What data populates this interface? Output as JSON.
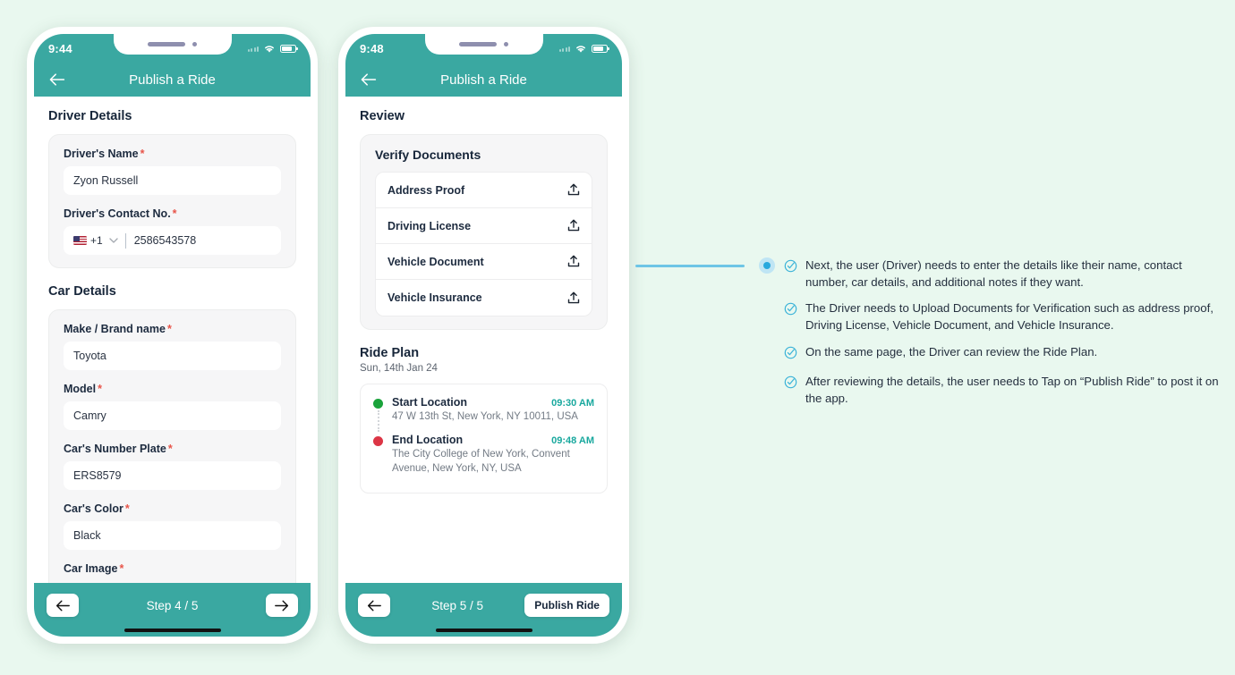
{
  "background_color": "#e9f8ef",
  "accent_color": "#3aa8a1",
  "phones": [
    {
      "name": "step-4-driver-car-details",
      "status_bar": {
        "time": "9:44",
        "wifi_icon": "wifi-icon",
        "battery_icon": "battery-icon",
        "signal_icon": "signal-icon"
      },
      "app_bar": {
        "back_icon": "back-arrow-icon",
        "title": "Publish a Ride"
      },
      "sections": [
        {
          "title": "Driver Details",
          "fields": [
            {
              "label": "Driver's Name",
              "required": "*",
              "value": "Zyon Russell",
              "type": "text"
            },
            {
              "label": "Driver's Contact No.",
              "required": "*",
              "value": "2586543578",
              "type": "phone",
              "country_code": "+1",
              "flag_icon": "us-flag-icon",
              "chevron_icon": "chevron-down-icon"
            }
          ]
        },
        {
          "title": "Car Details",
          "fields": [
            {
              "label": "Make / Brand name",
              "required": "*",
              "value": "Toyota",
              "type": "text"
            },
            {
              "label": "Model",
              "required": "*",
              "value": "Camry",
              "type": "text"
            },
            {
              "label": "Car's Number Plate",
              "required": "*",
              "value": "ERS8579",
              "type": "text"
            },
            {
              "label": "Car's Color",
              "required": "*",
              "value": "Black",
              "type": "text"
            },
            {
              "label": "Car Image",
              "required": "*",
              "value": "",
              "type": "cut-off"
            }
          ]
        }
      ],
      "bottom_bar": {
        "prev_icon": "arrow-left-icon",
        "step_label": "Step 4 / 5",
        "next_icon": "arrow-right-icon"
      }
    },
    {
      "name": "step-5-review",
      "status_bar": {
        "time": "9:48",
        "wifi_icon": "wifi-icon",
        "battery_icon": "battery-icon",
        "signal_icon": "signal-icon"
      },
      "app_bar": {
        "back_icon": "back-arrow-icon",
        "title": "Publish a Ride"
      },
      "review": {
        "section_title": "Review",
        "card_title": "Verify Documents",
        "documents": [
          {
            "label": "Address Proof",
            "upload_icon": "upload-icon"
          },
          {
            "label": "Driving License",
            "upload_icon": "upload-icon"
          },
          {
            "label": "Vehicle Document",
            "upload_icon": "upload-icon"
          },
          {
            "label": "Vehicle Insurance",
            "upload_icon": "upload-icon"
          }
        ]
      },
      "ride_plan": {
        "title": "Ride Plan",
        "date": "Sun, 14th Jan 24",
        "legs": [
          {
            "marker": "start-marker-green",
            "name": "Start Location",
            "time": "09:30 AM",
            "address": "47 W 13th St, New York, NY 10011, USA"
          },
          {
            "marker": "end-marker-red",
            "name": "End Location",
            "time": "09:48 AM",
            "address": "The City College of New York, Convent Avenue, New York, NY, USA"
          }
        ]
      },
      "bottom_bar": {
        "prev_icon": "arrow-left-icon",
        "step_label": "Step 5 / 5",
        "publish_label": "Publish Ride"
      }
    }
  ],
  "annotations": {
    "check_icon": "circle-check-icon",
    "items": [
      "Next, the user (Driver) needs to enter the details like their name, contact number, car details, and additional notes if they want.",
      "The Driver needs to Upload Documents for Verification such as address proof, Driving License, Vehicle Document, and Vehicle Insurance.",
      "On the same page, the Driver can review the Ride Plan.",
      "After reviewing the details, the user needs to Tap on “Publish Ride” to post it on the app."
    ]
  }
}
